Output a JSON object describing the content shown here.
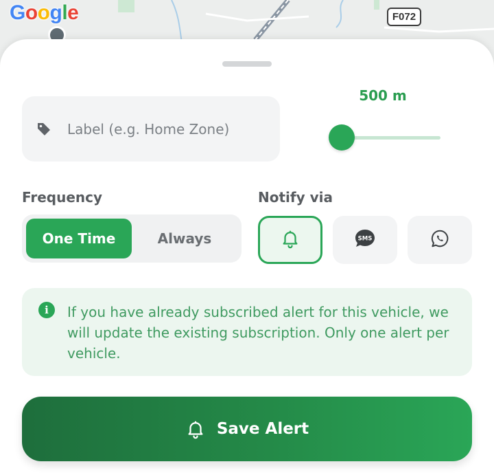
{
  "map": {
    "logo_letters": [
      {
        "ch": "G",
        "color": "#4285F4"
      },
      {
        "ch": "o",
        "color": "#EA4335"
      },
      {
        "ch": "o",
        "color": "#FBBC05"
      },
      {
        "ch": "g",
        "color": "#4285F4"
      },
      {
        "ch": "l",
        "color": "#34A853"
      },
      {
        "ch": "e",
        "color": "#EA4335"
      }
    ],
    "road_badge": "F072"
  },
  "form": {
    "label_placeholder": "Label (e.g. Home Zone)",
    "label_value": "",
    "radius_value": "500 m",
    "radius_slider_fraction": 0.05
  },
  "frequency": {
    "title": "Frequency",
    "options": [
      "One Time",
      "Always"
    ],
    "selected": "One Time"
  },
  "notify": {
    "title": "Notify via",
    "channels": [
      {
        "icon": "bell-icon",
        "selected": true
      },
      {
        "icon": "sms-icon",
        "text": "SMS",
        "selected": false
      },
      {
        "icon": "whatsapp-icon",
        "selected": false
      }
    ]
  },
  "info": {
    "icon_glyph": "i",
    "text": "If you have already subscribed alert for this vehicle, we will update the existing subscription. Only one alert per vehicle."
  },
  "save": {
    "label": "Save Alert"
  },
  "colors": {
    "accent": "#2aa657",
    "accent_dark": "#1e6e3c",
    "info_bg": "#ecf6ef",
    "info_text": "#3f9a60"
  }
}
